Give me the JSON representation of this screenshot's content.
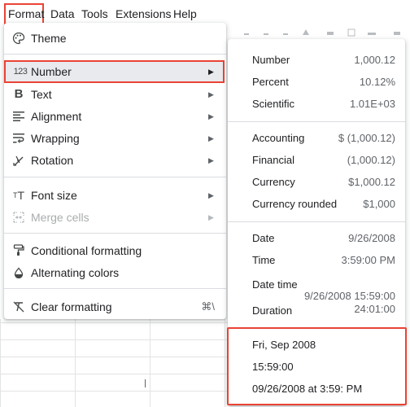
{
  "menubar": {
    "items": [
      {
        "label": "Format"
      },
      {
        "label": "Data"
      },
      {
        "label": "Tools"
      },
      {
        "label": "Extensions"
      },
      {
        "label": "Help"
      }
    ]
  },
  "format_menu": {
    "items": [
      {
        "label": "Theme",
        "icon": "palette-icon"
      },
      {
        "label": "Number",
        "icon": "number-format-icon",
        "has_submenu": true,
        "highlighted": true
      },
      {
        "label": "Text",
        "icon": "bold-icon",
        "has_submenu": true
      },
      {
        "label": "Alignment",
        "icon": "align-left-icon",
        "has_submenu": true
      },
      {
        "label": "Wrapping",
        "icon": "text-wrap-icon",
        "has_submenu": true
      },
      {
        "label": "Rotation",
        "icon": "text-rotation-icon",
        "has_submenu": true
      },
      {
        "label": "Font size",
        "icon": "font-size-icon",
        "has_submenu": true
      },
      {
        "label": "Merge cells",
        "icon": "merge-cells-icon",
        "has_submenu": true,
        "disabled": true
      },
      {
        "label": "Conditional formatting",
        "icon": "paint-roller-icon"
      },
      {
        "label": "Alternating colors",
        "icon": "color-fill-icon"
      },
      {
        "label": "Clear formatting",
        "icon": "clear-format-icon",
        "shortcut": "⌘\\"
      }
    ]
  },
  "number_submenu": {
    "items": [
      {
        "name": "Number",
        "example": "1,000.12"
      },
      {
        "name": "Percent",
        "example": "10.12%"
      },
      {
        "name": "Scientific",
        "example": "1.01E+03"
      },
      {
        "name": "Accounting",
        "example": "$ (1,000.12)"
      },
      {
        "name": "Financial",
        "example": "(1,000.12)"
      },
      {
        "name": "Currency",
        "example": "$1,000.12"
      },
      {
        "name": "Currency rounded",
        "example": "$1,000"
      },
      {
        "name": "Date",
        "example": "9/26/2008"
      },
      {
        "name": "Time",
        "example": "3:59:00 PM"
      }
    ],
    "date_time": {
      "name": "Date time",
      "example_line1": "9/26/2008 15:59:00",
      "example_line2": "24:01:00"
    },
    "duration": {
      "name": "Duration"
    },
    "custom": [
      {
        "label": "Fri, Sep 2008"
      },
      {
        "label": "15:59:00"
      },
      {
        "label": "09/26/2008 at 3:59: PM"
      }
    ]
  },
  "colors": {
    "highlight_border": "#ea4335",
    "menu_hover": "#e8eaed",
    "text": "#202124",
    "secondary_text": "#5f6368",
    "disabled_text": "#a9acaf"
  }
}
